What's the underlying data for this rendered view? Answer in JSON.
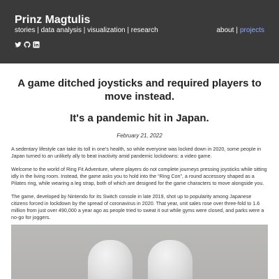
{
  "header": {
    "site_name": "Prinz Magtulis",
    "tagline": "stories | data analysis | visualization | research",
    "social_icons": [
      "twitter-icon",
      "github-icon",
      "linkedin-icon"
    ],
    "nav": {
      "about": "about",
      "separator": "|",
      "projects": "projects"
    },
    "colors": {
      "bar": "#3a3a3a",
      "projects_link": "#8fa8ff"
    }
  },
  "article": {
    "headline": "A game ditched joysticks and required players to move instead.",
    "subheadline": "It's a pandemic hit in Japan.",
    "date": "February 21, 2022",
    "paragraphs": [
      "A sedentary lifestyle can take its toll in one's health, so while everyone was locked down in 2020, some people in Japan turned to an unlikely ally to beat inactivity amid pandemic lockdowns: a video game.",
      "Welcome to the world of Ring Fit Adventure, where players do not complete journeys pressing joysticks while sitting idly in the living room. Instead, the game asks you to hold into the “Ring Con”, a round accessory shaped as a Pilates ring, while wearing a leg strap, both of which are designed for the game characters to move alongside you.",
      "The game, developed by Nintendo for its Switch console in late 2019, shot up to popularity among Japanese citizens forced in lockdown by the spread of coronavirus in 2020. That year, unit sales rose over three-fold to 1.6 million from just over 490,000 a year ago as people tried to sweat it out while gyms were closed, and parks were a no-go for joggers."
    ]
  }
}
